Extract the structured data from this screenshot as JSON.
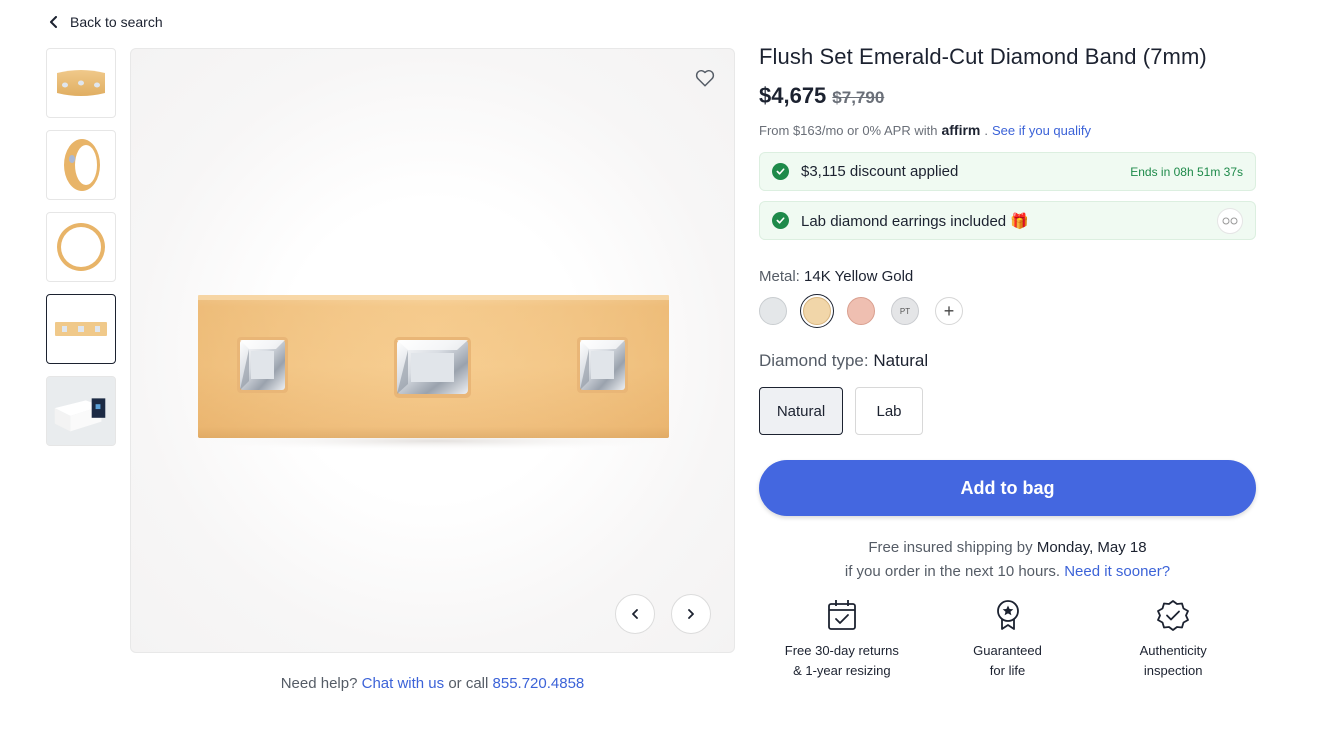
{
  "nav": {
    "back_label": "Back to search"
  },
  "thumbnails": [
    {
      "name": "band-front-thumb"
    },
    {
      "name": "band-angle-thumb"
    },
    {
      "name": "band-side-thumb"
    },
    {
      "name": "band-flat-thumb",
      "active": true
    },
    {
      "name": "box-packaging-thumb"
    }
  ],
  "gallery": {
    "favorite_icon": "heart-icon",
    "prev_icon": "chevron-left-icon",
    "next_icon": "chevron-right-icon"
  },
  "help": {
    "prefix": "Need help?",
    "chat_label": "Chat with us",
    "middle": "or call",
    "phone": "855.720.4858"
  },
  "product": {
    "title": "Flush Set Emerald-Cut Diamond Band (7mm)",
    "price": "$4,675",
    "original_price": "$7,790",
    "finance_text": "From $163/mo or 0% APR with",
    "finance_brand": "affirm",
    "finance_link": "See if you qualify"
  },
  "promos": {
    "discount_label": "$3,115 discount applied",
    "discount_timer": "Ends in 08h 51m 37s",
    "gift_label": "Lab diamond earrings included 🎁"
  },
  "metal": {
    "label": "Metal:",
    "value": "14K Yellow Gold",
    "options": [
      {
        "name": "white-gold",
        "color": "#e4e7e9"
      },
      {
        "name": "yellow-gold",
        "color": "#f1d6a9",
        "selected": true
      },
      {
        "name": "rose-gold",
        "color": "#efbfb1"
      },
      {
        "name": "platinum",
        "label": "PT",
        "color": "#e4e5e7"
      },
      {
        "name": "more",
        "label": "+"
      }
    ]
  },
  "diamond": {
    "label": "Diamond type:",
    "value": "Natural",
    "options": [
      "Natural",
      "Lab"
    ],
    "selected": "Natural"
  },
  "cta": {
    "add_to_bag": "Add to bag"
  },
  "shipping": {
    "line1_prefix": "Free insured shipping by",
    "date": "Monday, May 18",
    "line2": "if you order in the next 10 hours.",
    "link": "Need it sooner?"
  },
  "perks": [
    {
      "icon": "calendar-check-icon",
      "line1": "Free 30-day returns",
      "line2": "& 1-year resizing"
    },
    {
      "icon": "award-ribbon-icon",
      "line1": "Guaranteed",
      "line2": "for life"
    },
    {
      "icon": "verified-badge-icon",
      "line1": "Authenticity",
      "line2": "inspection"
    }
  ],
  "colors": {
    "accent": "#4467e0",
    "link": "#3c63d8",
    "success": "#1e8a4a",
    "promo_bg": "#f0faf2"
  }
}
